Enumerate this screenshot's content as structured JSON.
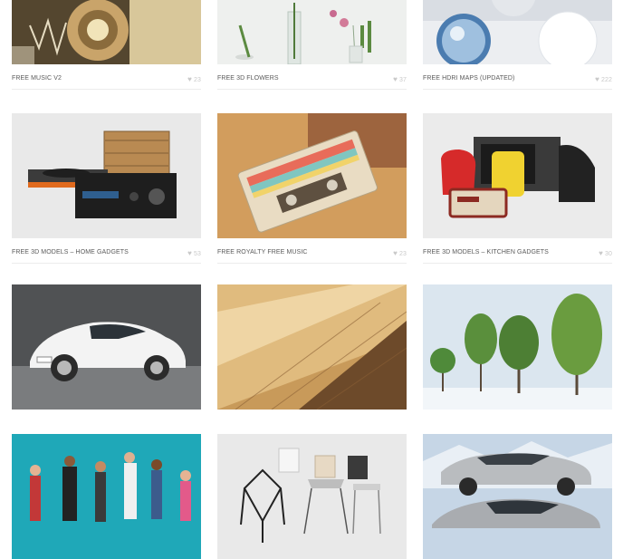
{
  "rows": [
    {
      "items": [
        {
          "title": "FREE MUSIC V2",
          "likes": "23",
          "image": "music-v2-thumbnail"
        },
        {
          "title": "FREE 3D FLOWERS",
          "likes": "37",
          "image": "3d-flowers-thumbnail"
        },
        {
          "title": "FREE HDRI MAPS (UPDATED)",
          "likes": "222",
          "image": "hdri-maps-thumbnail"
        }
      ]
    },
    {
      "items": [
        {
          "title": "FREE 3D MODELS – HOME GADGETS",
          "likes": "53",
          "image": "home-gadgets-thumbnail"
        },
        {
          "title": "FREE ROYALTY FREE MUSIC",
          "likes": "23",
          "image": "royalty-free-music-thumbnail"
        },
        {
          "title": "FREE 3D MODELS – KITCHEN GADGETS",
          "likes": "30",
          "image": "kitchen-gadgets-thumbnail"
        }
      ]
    },
    {
      "items": [
        {
          "title": "",
          "likes": "",
          "image": "white-car-thumbnail"
        },
        {
          "title": "",
          "likes": "",
          "image": "wood-floor-thumbnail"
        },
        {
          "title": "",
          "likes": "",
          "image": "trees-thumbnail"
        }
      ]
    },
    {
      "items": [
        {
          "title": "",
          "likes": "",
          "image": "people-thumbnail"
        },
        {
          "title": "",
          "likes": "",
          "image": "chairs-thumbnail"
        },
        {
          "title": "",
          "likes": "",
          "image": "delorean-thumbnail"
        }
      ]
    }
  ],
  "icons": {
    "like": "heart-icon"
  },
  "colors": {
    "title_text": "#5a5a5a",
    "likes_text": "#c9c9c9",
    "divider": "#ececec"
  }
}
